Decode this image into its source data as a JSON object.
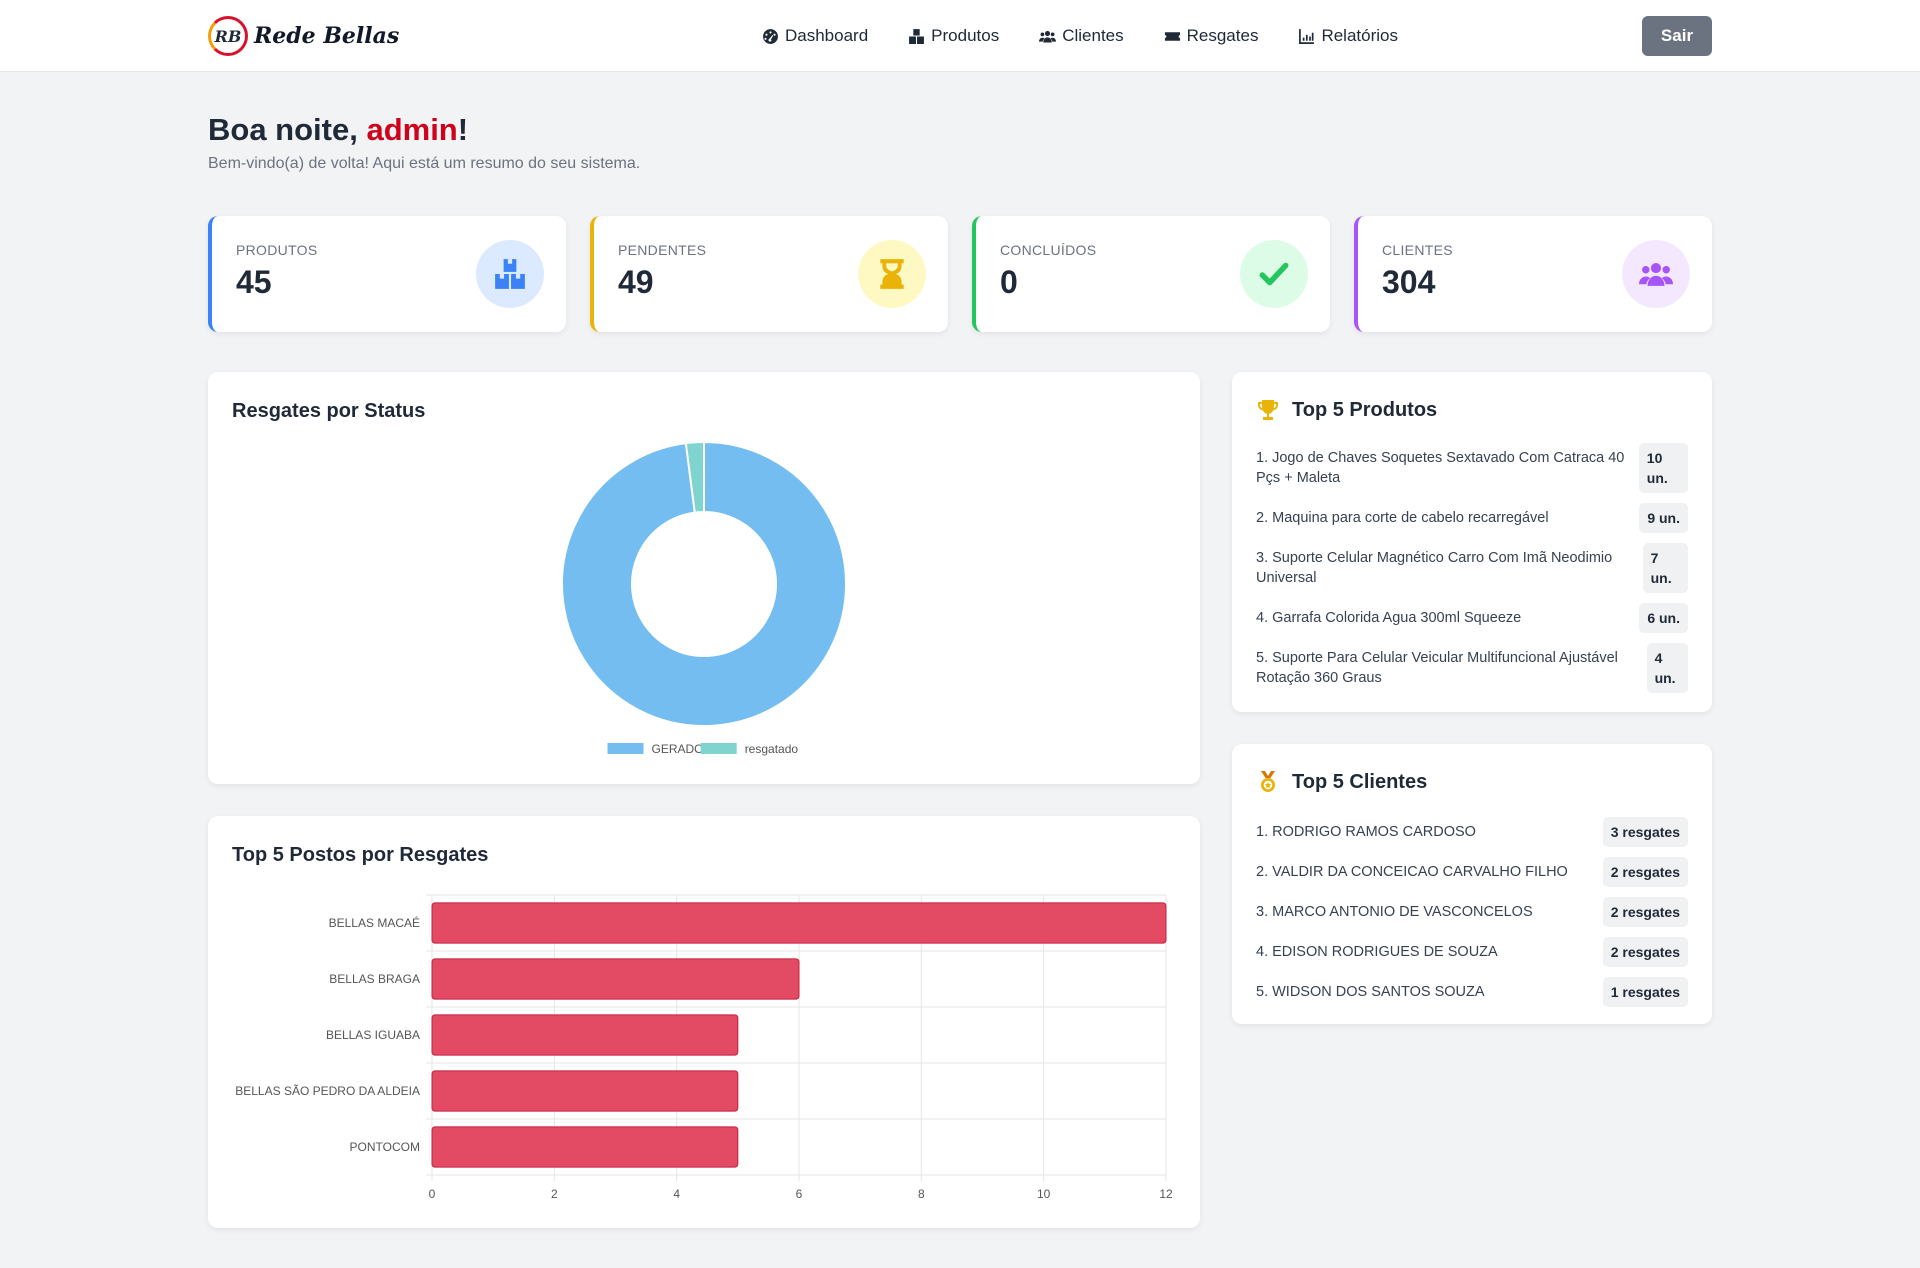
{
  "brand": {
    "logo_text": "RB",
    "name": "Rede Bellas"
  },
  "nav": [
    {
      "label": "Dashboard",
      "icon": "gauge-icon"
    },
    {
      "label": "Produtos",
      "icon": "boxes-icon"
    },
    {
      "label": "Clientes",
      "icon": "users-icon"
    },
    {
      "label": "Resgates",
      "icon": "ticket-icon"
    },
    {
      "label": "Relatórios",
      "icon": "chart-line-icon"
    }
  ],
  "logout_label": "Sair",
  "greeting": {
    "prefix": "Boa noite, ",
    "user": "admin",
    "suffix": "!",
    "subtitle": "Bem-vindo(a) de volta! Aqui está um resumo do seu sistema."
  },
  "stats": [
    {
      "label": "PRODUTOS",
      "value": "45",
      "icon": "boxes-icon",
      "color": "#3b82f6",
      "bg": "#dbeafe"
    },
    {
      "label": "PENDENTES",
      "value": "49",
      "icon": "hourglass-icon",
      "color": "#eab308",
      "bg": "#fef9c3"
    },
    {
      "label": "CONCLUÍDOS",
      "value": "0",
      "icon": "check-icon",
      "color": "#22c55e",
      "bg": "#dcfce7"
    },
    {
      "label": "CLIENTES",
      "value": "304",
      "icon": "users-icon",
      "color": "#a855f7",
      "bg": "#f3e8ff"
    }
  ],
  "status_chart_title": "Resgates por Status",
  "postos_chart_title": "Top 5 Postos por Resgates",
  "top_produtos": {
    "title": "Top 5 Produtos",
    "items": [
      {
        "name": "1. Jogo de Chaves Soquetes Sextavado Com Catraca 40 Pçs + Maleta",
        "badge": "10 un."
      },
      {
        "name": "2. Maquina para corte de cabelo recarregável",
        "badge": "9 un."
      },
      {
        "name": "3. Suporte Celular Magnético Carro Com Imã Neodimio Universal",
        "badge": "7 un."
      },
      {
        "name": "4. Garrafa Colorida Agua 300ml Squeeze",
        "badge": "6 un."
      },
      {
        "name": "5. Suporte Para Celular Veicular Multifuncional Ajustável Rotação 360 Graus",
        "badge": "4 un."
      }
    ]
  },
  "top_clientes": {
    "title": "Top 5 Clientes",
    "items": [
      {
        "name": "1. RODRIGO RAMOS CARDOSO",
        "badge": "3 resgates"
      },
      {
        "name": "2. VALDIR DA CONCEICAO CARVALHO FILHO",
        "badge": "2 resgates"
      },
      {
        "name": "3. MARCO ANTONIO DE VASCONCELOS",
        "badge": "2 resgates"
      },
      {
        "name": "4. EDISON RODRIGUES DE SOUZA",
        "badge": "2 resgates"
      },
      {
        "name": "5. WIDSON DOS SANTOS SOUZA",
        "badge": "1 resgates"
      }
    ]
  },
  "chart_data": [
    {
      "type": "pie",
      "title": "Resgates por Status",
      "donut": true,
      "categories": [
        "GERADO",
        "resgatado"
      ],
      "values": [
        48,
        1
      ],
      "colors": [
        "#74bdf0",
        "#80d4d0"
      ],
      "legend": "bottom"
    },
    {
      "type": "bar",
      "orientation": "horizontal",
      "title": "Top 5 Postos por Resgates",
      "categories": [
        "BELLAS MACAÉ",
        "BELLAS BRAGA",
        "BELLAS IGUABA",
        "BELLAS SÃO PEDRO DA ALDEIA",
        "PONTOCOM"
      ],
      "values": [
        12,
        6,
        5,
        5,
        5
      ],
      "xlim": [
        0,
        12
      ],
      "xticks": [
        0,
        2,
        4,
        6,
        8,
        10,
        12
      ],
      "color": "#e34b64",
      "grid": true
    }
  ]
}
